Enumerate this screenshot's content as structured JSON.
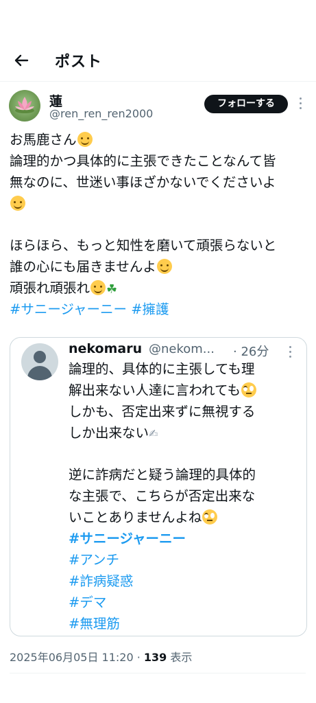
{
  "header": {
    "title": "ポスト",
    "back_icon": "arrow-left-icon"
  },
  "author": {
    "display_name": "蓮",
    "handle": "@ren_ren_ren2000",
    "follow_label": "フォローする"
  },
  "post": {
    "lines": [
      "お馬鹿さん",
      "論理的かつ具体的に主張できたことなんて皆",
      "無なのに、世迷い事ほざかないでくださいよ",
      "ほらほら、もっと知性を磨いて頑張らないと",
      "誰の心にも届きませんよ",
      "頑張れ頑張れ"
    ],
    "hashtags": [
      "#サニージャーニー",
      "#擁護"
    ]
  },
  "quote": {
    "display_name": "nekomaru",
    "handle": "@nekom...",
    "time": "· 26分",
    "lines": [
      "論理的、具体的に主張しても理",
      "解出来ない人達に言われても",
      "しかも、否定出来ずに無視する",
      "しか出来ない",
      "逆に詐病だと疑う論理的具体的",
      "な主張で、こちらが否定出来な",
      "いことありませんよね"
    ],
    "hashtags": [
      "#サニージャーニー",
      "#アンチ",
      "#詐病疑惑",
      "#デマ",
      "#無理筋"
    ]
  },
  "meta": {
    "datetime": "2025年06月05日 11:20 ·",
    "views": "139",
    "views_label": "表示"
  },
  "colors": {
    "accent": "#1d9bf0",
    "text": "#0f1419",
    "muted": "#536471"
  }
}
